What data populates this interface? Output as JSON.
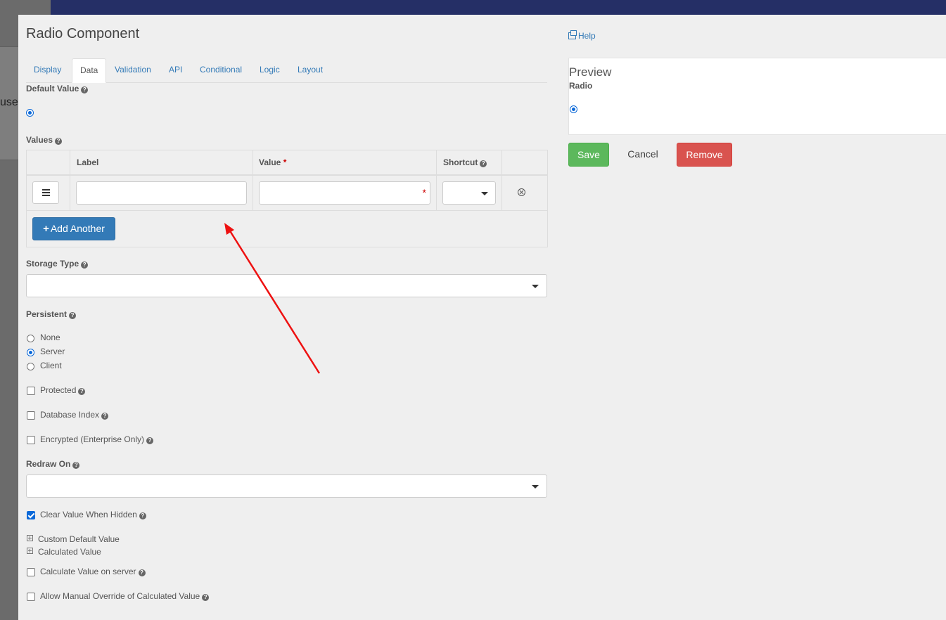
{
  "background": {
    "peek_text": "use"
  },
  "modal": {
    "title": "Radio Component",
    "tabs": [
      {
        "label": "Display"
      },
      {
        "label": "Data"
      },
      {
        "label": "Validation"
      },
      {
        "label": "API"
      },
      {
        "label": "Conditional"
      },
      {
        "label": "Logic"
      },
      {
        "label": "Layout"
      }
    ],
    "active_tab": "Data"
  },
  "form": {
    "default_value_label": "Default Value",
    "values_label": "Values",
    "values_table": {
      "headers": {
        "label": "Label",
        "value": "Value",
        "shortcut": "Shortcut"
      },
      "required_marker": "*",
      "add_another": "Add Another"
    },
    "storage_type_label": "Storage Type",
    "persistent_label": "Persistent",
    "persistent_options": [
      {
        "label": "None",
        "selected": false
      },
      {
        "label": "Server",
        "selected": true
      },
      {
        "label": "Client",
        "selected": false
      }
    ],
    "protected_label": "Protected",
    "database_index_label": "Database Index",
    "encrypted_label": "Encrypted (Enterprise Only)",
    "redraw_on_label": "Redraw On",
    "clear_value_label": "Clear Value When Hidden",
    "custom_default_label": "Custom Default Value",
    "calculated_value_label": "Calculated Value",
    "calculate_on_server_label": "Calculate Value on server",
    "allow_override_label": "Allow Manual Override of Calculated Value"
  },
  "side": {
    "help_label": "Help",
    "preview_title": "Preview",
    "preview_field_label": "Radio",
    "save_label": "Save",
    "cancel_label": "Cancel",
    "remove_label": "Remove"
  },
  "colors": {
    "primary": "#337ab7",
    "success": "#5cb85c",
    "danger": "#d9534f",
    "annotation_arrow": "#ee1111",
    "topbar": "#252f66"
  }
}
